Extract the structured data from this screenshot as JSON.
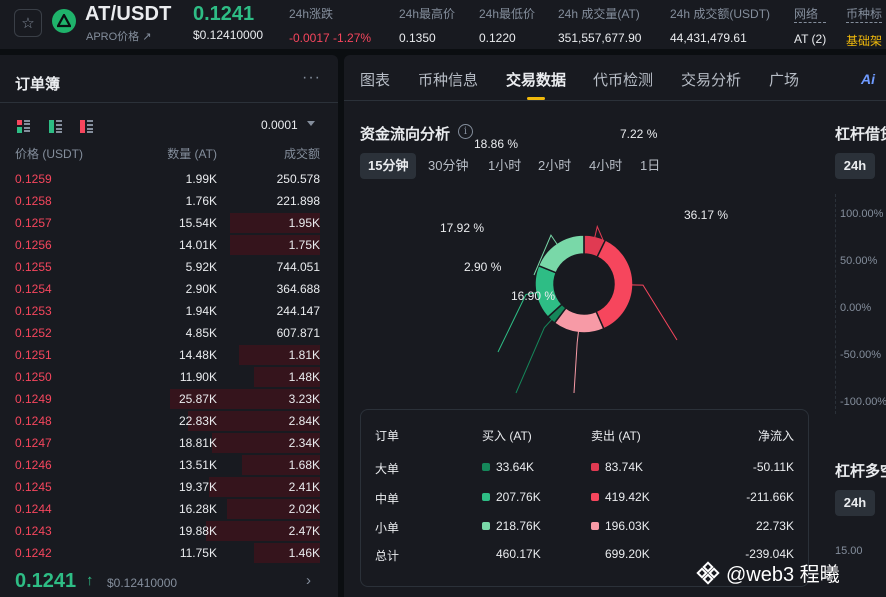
{
  "header": {
    "pair": "AT/USDT",
    "sub_label": "APRO价格 ↗",
    "last_price": "0.1241",
    "last_price_usd": "$0.12410000",
    "stats": [
      {
        "label": "24h涨跌",
        "value": "-0.0017 -1.27%",
        "tone": "neg"
      },
      {
        "label": "24h最高价",
        "value": "0.1350",
        "tone": ""
      },
      {
        "label": "24h最低价",
        "value": "0.1220",
        "tone": ""
      },
      {
        "label": "24h 成交量(AT)",
        "value": "351,557,677.90",
        "tone": ""
      },
      {
        "label": "24h 成交额(USDT)",
        "value": "44,431,479.61",
        "tone": ""
      },
      {
        "label": "网络",
        "value": "AT (2)",
        "tone": ""
      },
      {
        "label": "币种标",
        "value": "基础架",
        "tone": "gold"
      }
    ]
  },
  "orderbook": {
    "title": "订单簿",
    "more": "···",
    "tick_size": "0.0001",
    "headers": {
      "price": "价格 (USDT)",
      "qty": "数量 (AT)",
      "total": "成交额"
    },
    "rows": [
      {
        "price": "0.1259",
        "qty": "1.99K",
        "total": "250.578",
        "depth": 0
      },
      {
        "price": "0.1258",
        "qty": "1.76K",
        "total": "221.898",
        "depth": 0
      },
      {
        "price": "0.1257",
        "qty": "15.54K",
        "total": "1.95K",
        "depth": 0.3
      },
      {
        "price": "0.1256",
        "qty": "14.01K",
        "total": "1.75K",
        "depth": 0.3
      },
      {
        "price": "0.1255",
        "qty": "5.92K",
        "total": "744.051",
        "depth": 0
      },
      {
        "price": "0.1254",
        "qty": "2.90K",
        "total": "364.688",
        "depth": 0
      },
      {
        "price": "0.1253",
        "qty": "1.94K",
        "total": "244.147",
        "depth": 0
      },
      {
        "price": "0.1252",
        "qty": "4.85K",
        "total": "607.871",
        "depth": 0
      },
      {
        "price": "0.1251",
        "qty": "14.48K",
        "total": "1.81K",
        "depth": 0.27
      },
      {
        "price": "0.1250",
        "qty": "11.90K",
        "total": "1.48K",
        "depth": 0.22
      },
      {
        "price": "0.1249",
        "qty": "25.87K",
        "total": "3.23K",
        "depth": 0.5
      },
      {
        "price": "0.1248",
        "qty": "22.83K",
        "total": "2.84K",
        "depth": 0.44
      },
      {
        "price": "0.1247",
        "qty": "18.81K",
        "total": "2.34K",
        "depth": 0.36
      },
      {
        "price": "0.1246",
        "qty": "13.51K",
        "total": "1.68K",
        "depth": 0.26
      },
      {
        "price": "0.1245",
        "qty": "19.37K",
        "total": "2.41K",
        "depth": 0.37
      },
      {
        "price": "0.1244",
        "qty": "16.28K",
        "total": "2.02K",
        "depth": 0.31
      },
      {
        "price": "0.1243",
        "qty": "19.88K",
        "total": "2.47K",
        "depth": 0.38
      },
      {
        "price": "0.1242",
        "qty": "11.75K",
        "total": "1.46K",
        "depth": 0.22
      }
    ],
    "last_price": "0.1241",
    "last_arrow": "↑",
    "last_usd": "$0.12410000",
    "next": "›"
  },
  "tabs": [
    "图表",
    "币种信息",
    "交易数据",
    "代币检测",
    "交易分析",
    "广场"
  ],
  "active_tab": 2,
  "ai_badge": "Ai",
  "flow": {
    "title": "资金流向分析",
    "info": "i",
    "ranges": [
      "15分钟",
      "30分钟",
      "1小时",
      "2小时",
      "4小时",
      "1日"
    ],
    "active_range": 0,
    "colors": {
      "sell_large": "#e03a52",
      "sell_mid": "#f6465d",
      "sell_small": "#f79aa6",
      "buy_small": "#79d8a8",
      "buy_mid": "#2ebd85",
      "buy_large": "#15875a"
    },
    "slices": [
      {
        "key": "sell_large",
        "percent": 7.22,
        "label": "7.22 %"
      },
      {
        "key": "sell_mid",
        "percent": 36.17,
        "label": "36.17 %"
      },
      {
        "key": "sell_small",
        "percent": 16.9,
        "label": "16.90 %"
      },
      {
        "key": "buy_large",
        "percent": 2.9,
        "label": "2.90 %"
      },
      {
        "key": "buy_mid",
        "percent": 17.92,
        "label": "17.92 %"
      },
      {
        "key": "buy_small",
        "percent": 18.86,
        "label": "18.86 %"
      }
    ],
    "table": {
      "headers": [
        "订单",
        "买入 (AT)",
        "卖出 (AT)",
        "净流入"
      ],
      "rows": [
        {
          "name": "大单",
          "buy": "33.64K",
          "sell": "83.74K",
          "net": "-50.11K",
          "buy_color": "#15875a",
          "sell_color": "#e03a52"
        },
        {
          "name": "中单",
          "buy": "207.76K",
          "sell": "419.42K",
          "net": "-211.66K",
          "buy_color": "#2ebd85",
          "sell_color": "#f6465d"
        },
        {
          "name": "小单",
          "buy": "218.76K",
          "sell": "196.03K",
          "net": "22.73K",
          "buy_color": "#79d8a8",
          "sell_color": "#f79aa6"
        },
        {
          "name": "总计",
          "buy": "460.17K",
          "sell": "699.20K",
          "net": "-239.04K",
          "buy_color": "",
          "sell_color": ""
        }
      ]
    }
  },
  "leverage": {
    "title": "杠杆借贷",
    "period": "24h",
    "ticks": [
      "100.00%",
      "50.00%",
      "0.00%",
      "-50.00%",
      "-100.00%"
    ],
    "title2": "杠杆多空",
    "period2": "24h",
    "tick2": "15.00"
  },
  "watermark": "@web3  程曦"
}
